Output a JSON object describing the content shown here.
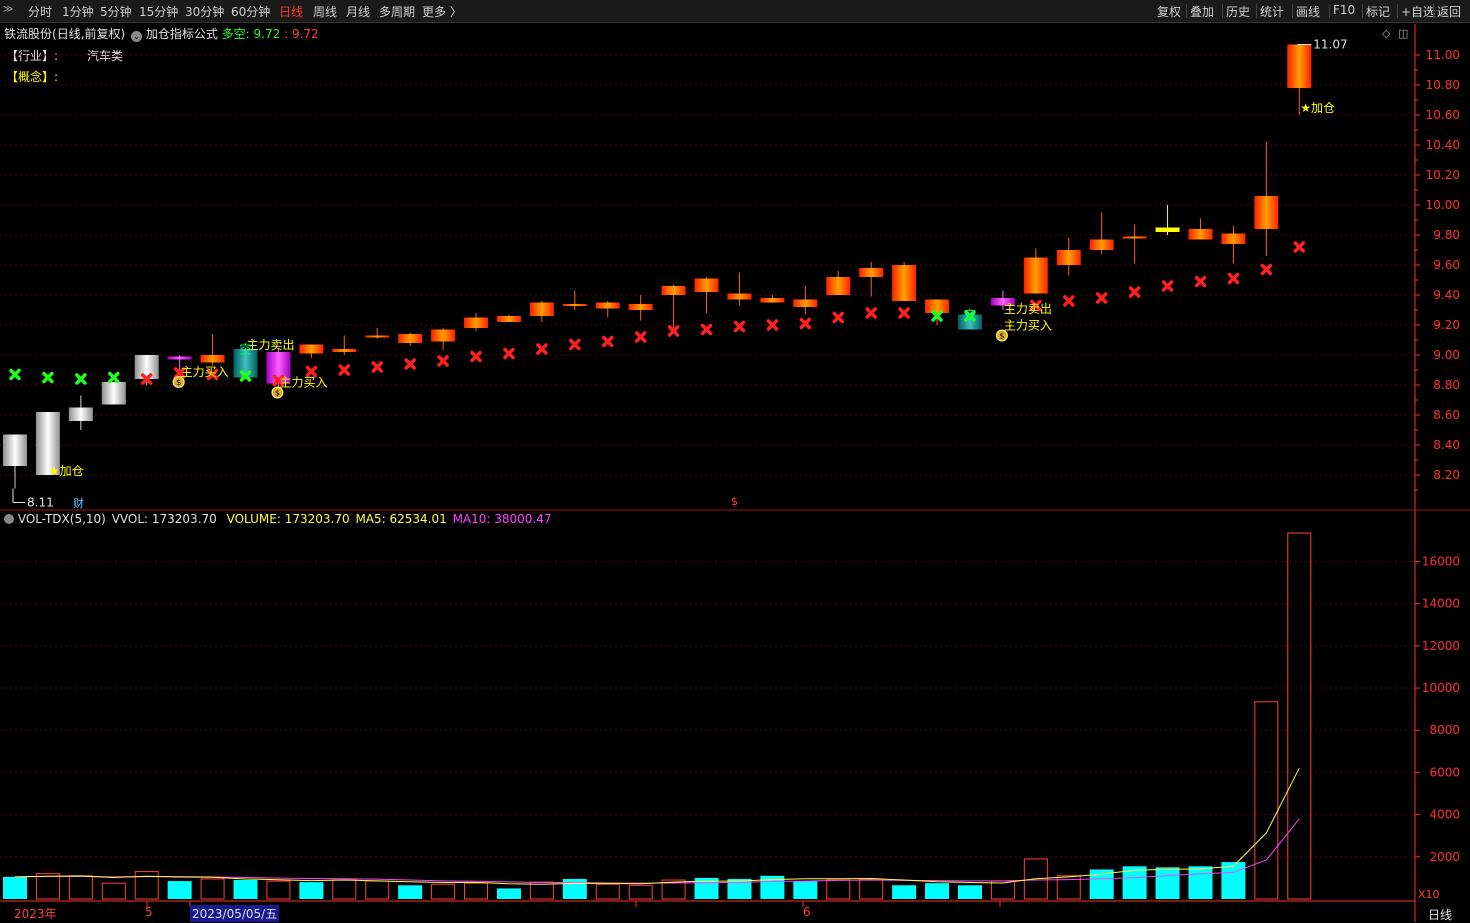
{
  "toolbar": {
    "left": [
      "分时",
      "1分钟",
      "5分钟",
      "15分钟",
      "30分钟",
      "60分钟",
      "日线",
      "周线",
      "月线",
      "多周期",
      "更多 〉"
    ],
    "active_index": 6,
    "right": [
      "复权",
      "叠加",
      "历史",
      "统计",
      "画线",
      "F10",
      "标记",
      "+自选",
      "返回"
    ]
  },
  "header": {
    "stock_name": "铁流股份",
    "mode": "(日线,前复权)",
    "formula": "加仓指标公式",
    "duokong_label": "多空:",
    "duokong_val1": "9.72",
    "duokong_val2": "9.72",
    "industry_label": "【行业】:",
    "industry_value": "汽车类",
    "concept_label": "【概念】:"
  },
  "volume_header": {
    "indicator": "VOL-TDX(5,10)",
    "vvol_label": "VVOL: 173203.70",
    "volume_label": "VOLUME: 173203.70",
    "ma5_label": "MA5: 62534.01",
    "ma10_label": "MA10: 38000.47"
  },
  "bottom": {
    "year_label": "2023年",
    "date_label": "2023/05/05/五",
    "month5": "5",
    "month6": "6",
    "period_label": "日线",
    "x10_label": "X10",
    "cai_label": "财",
    "dollar_label": "$"
  },
  "colors": {
    "up": "#ff4020",
    "down_white": "#e8e8e8",
    "vol_down": "#00ffff",
    "vol_up": "#ff4040",
    "ma5": "#ffff40",
    "ma10": "#ff40ff",
    "grid": "#4a0c0c",
    "axis": "#ff3030",
    "signal_red": "#ff2020",
    "signal_green": "#20ff20"
  },
  "chart_data": {
    "type": "candlestick",
    "y_axis": {
      "ticks": [
        "8.20",
        "8.40",
        "8.60",
        "8.80",
        "9.00",
        "9.20",
        "9.40",
        "9.60",
        "9.80",
        "10.00",
        "10.20",
        "10.40",
        "10.60",
        "10.80",
        "11.00"
      ],
      "range": [
        8.04,
        11.07
      ]
    },
    "candles": [
      {
        "o": 8.47,
        "c": 8.26,
        "h": 8.47,
        "l": 8.11,
        "style": "white"
      },
      {
        "o": 8.62,
        "c": 8.2,
        "h": 8.62,
        "l": 8.2,
        "style": "white"
      },
      {
        "o": 8.65,
        "c": 8.56,
        "h": 8.73,
        "l": 8.5,
        "style": "white"
      },
      {
        "o": 8.82,
        "c": 8.67,
        "h": 8.82,
        "l": 8.67,
        "style": "white"
      },
      {
        "o": 9.0,
        "c": 8.84,
        "h": 9.0,
        "l": 8.8,
        "style": "white"
      },
      {
        "o": 8.99,
        "c": 8.97,
        "h": 9.0,
        "l": 8.89,
        "style": "magenta"
      },
      {
        "o": 8.95,
        "c": 9.0,
        "h": 9.14,
        "l": 8.93,
        "style": "up"
      },
      {
        "o": 9.04,
        "c": 8.85,
        "h": 9.05,
        "l": 8.84,
        "style": "teal"
      },
      {
        "o": 8.81,
        "c": 9.02,
        "h": 9.04,
        "l": 8.78,
        "style": "magenta"
      },
      {
        "o": 9.01,
        "c": 9.07,
        "h": 9.07,
        "l": 8.98,
        "style": "up"
      },
      {
        "o": 9.02,
        "c": 9.04,
        "h": 9.13,
        "l": 9.0,
        "style": "up"
      },
      {
        "o": 9.12,
        "c": 9.13,
        "h": 9.18,
        "l": 9.11,
        "style": "up"
      },
      {
        "o": 9.08,
        "c": 9.14,
        "h": 9.15,
        "l": 9.06,
        "style": "up"
      },
      {
        "o": 9.09,
        "c": 9.17,
        "h": 9.18,
        "l": 9.03,
        "style": "up"
      },
      {
        "o": 9.18,
        "c": 9.25,
        "h": 9.28,
        "l": 9.16,
        "style": "up"
      },
      {
        "o": 9.22,
        "c": 9.26,
        "h": 9.27,
        "l": 9.22,
        "style": "up"
      },
      {
        "o": 9.26,
        "c": 9.35,
        "h": 9.36,
        "l": 9.22,
        "style": "up"
      },
      {
        "o": 9.33,
        "c": 9.34,
        "h": 9.43,
        "l": 9.3,
        "style": "up"
      },
      {
        "o": 9.31,
        "c": 9.35,
        "h": 9.36,
        "l": 9.25,
        "style": "up"
      },
      {
        "o": 9.3,
        "c": 9.34,
        "h": 9.4,
        "l": 9.23,
        "style": "up"
      },
      {
        "o": 9.4,
        "c": 9.46,
        "h": 9.47,
        "l": 9.18,
        "style": "up"
      },
      {
        "o": 9.42,
        "c": 9.51,
        "h": 9.52,
        "l": 9.28,
        "style": "up"
      },
      {
        "o": 9.37,
        "c": 9.41,
        "h": 9.55,
        "l": 9.33,
        "style": "up"
      },
      {
        "o": 9.35,
        "c": 9.38,
        "h": 9.4,
        "l": 9.35,
        "style": "up"
      },
      {
        "o": 9.32,
        "c": 9.37,
        "h": 9.46,
        "l": 9.27,
        "style": "up"
      },
      {
        "o": 9.4,
        "c": 9.52,
        "h": 9.56,
        "l": 9.4,
        "style": "up"
      },
      {
        "o": 9.52,
        "c": 9.58,
        "h": 9.62,
        "l": 9.39,
        "style": "up"
      },
      {
        "o": 9.36,
        "c": 9.6,
        "h": 9.62,
        "l": 9.36,
        "style": "up"
      },
      {
        "o": 9.28,
        "c": 9.37,
        "h": 9.37,
        "l": 9.2,
        "style": "up"
      },
      {
        "o": 9.27,
        "c": 9.17,
        "h": 9.28,
        "l": 9.17,
        "style": "teal"
      },
      {
        "o": 9.33,
        "c": 9.38,
        "h": 9.43,
        "l": 9.3,
        "style": "magenta"
      },
      {
        "o": 9.41,
        "c": 9.65,
        "h": 9.71,
        "l": 9.41,
        "style": "up"
      },
      {
        "o": 9.6,
        "c": 9.7,
        "h": 9.78,
        "l": 9.53,
        "style": "up"
      },
      {
        "o": 9.7,
        "c": 9.77,
        "h": 9.95,
        "l": 9.67,
        "style": "up"
      },
      {
        "o": 9.79,
        "c": 9.79,
        "h": 9.87,
        "l": 9.61,
        "style": "up"
      },
      {
        "o": 9.82,
        "c": 9.85,
        "h": 10.0,
        "l": 9.8,
        "style": "yellow"
      },
      {
        "o": 9.77,
        "c": 9.84,
        "h": 9.91,
        "l": 9.77,
        "style": "up"
      },
      {
        "o": 9.74,
        "c": 9.81,
        "h": 9.86,
        "l": 9.61,
        "style": "up"
      },
      {
        "o": 9.84,
        "c": 10.06,
        "h": 10.42,
        "l": 9.66,
        "style": "up"
      },
      {
        "o": 10.78,
        "c": 11.07,
        "h": 11.07,
        "l": 10.6,
        "style": "up"
      }
    ],
    "signal_marks": [
      {
        "i": 0,
        "price": 8.87,
        "type": "green"
      },
      {
        "i": 1,
        "price": 8.85,
        "type": "green"
      },
      {
        "i": 2,
        "price": 8.84,
        "type": "green"
      },
      {
        "i": 3,
        "price": 8.85,
        "type": "green"
      },
      {
        "i": 4,
        "price": 8.84,
        "type": "red"
      },
      {
        "i": 5,
        "price": 8.88,
        "type": "red"
      },
      {
        "i": 6,
        "price": 8.87,
        "type": "red"
      },
      {
        "i": 7,
        "price": 8.86,
        "type": "green"
      },
      {
        "i": 8,
        "price": 8.83,
        "type": "red"
      },
      {
        "i": 9,
        "price": 8.89,
        "type": "red"
      },
      {
        "i": 10,
        "price": 8.9,
        "type": "red"
      },
      {
        "i": 11,
        "price": 8.92,
        "type": "red"
      },
      {
        "i": 12,
        "price": 8.94,
        "type": "red"
      },
      {
        "i": 13,
        "price": 8.96,
        "type": "red"
      },
      {
        "i": 14,
        "price": 8.99,
        "type": "red"
      },
      {
        "i": 15,
        "price": 9.01,
        "type": "red"
      },
      {
        "i": 16,
        "price": 9.04,
        "type": "red"
      },
      {
        "i": 17,
        "price": 9.07,
        "type": "red"
      },
      {
        "i": 18,
        "price": 9.09,
        "type": "red"
      },
      {
        "i": 19,
        "price": 9.12,
        "type": "red"
      },
      {
        "i": 20,
        "price": 9.16,
        "type": "red"
      },
      {
        "i": 21,
        "price": 9.17,
        "type": "red"
      },
      {
        "i": 22,
        "price": 9.19,
        "type": "red"
      },
      {
        "i": 23,
        "price": 9.2,
        "type": "red"
      },
      {
        "i": 24,
        "price": 9.21,
        "type": "red"
      },
      {
        "i": 25,
        "price": 9.25,
        "type": "red"
      },
      {
        "i": 26,
        "price": 9.28,
        "type": "red"
      },
      {
        "i": 27,
        "price": 9.28,
        "type": "red"
      },
      {
        "i": 28,
        "price": 9.26,
        "type": "green"
      },
      {
        "i": 29,
        "price": 9.26,
        "type": "green"
      },
      {
        "i": 31,
        "price": 9.33,
        "type": "red"
      },
      {
        "i": 32,
        "price": 9.36,
        "type": "red"
      },
      {
        "i": 33,
        "price": 9.38,
        "type": "red"
      },
      {
        "i": 34,
        "price": 9.42,
        "type": "red"
      },
      {
        "i": 35,
        "price": 9.46,
        "type": "red"
      },
      {
        "i": 36,
        "price": 9.49,
        "type": "red"
      },
      {
        "i": 37,
        "price": 9.51,
        "type": "red"
      },
      {
        "i": 38,
        "price": 9.57,
        "type": "red"
      },
      {
        "i": 39,
        "price": 9.72,
        "type": "red"
      }
    ],
    "annotations": [
      {
        "i": 1,
        "price": 8.2,
        "text": "★加仓",
        "color": "#ffff00"
      },
      {
        "i": 39,
        "price": 10.62,
        "text": "★加仓",
        "color": "#ffff00"
      },
      {
        "i": 5,
        "price": 8.86,
        "text": "主力买入",
        "color": "#ffff00",
        "coin": true
      },
      {
        "i": 8,
        "price": 8.79,
        "text": "主力买入",
        "color": "#ffff00",
        "coin": true
      },
      {
        "i": 7,
        "price": 9.04,
        "text": "主力卖出",
        "color": "#ffff00"
      },
      {
        "i": 30,
        "price": 9.28,
        "text": "主力卖出",
        "color": "#ffff00"
      },
      {
        "i": 30,
        "price": 9.17,
        "text": "主力买入",
        "color": "#ffff00",
        "coin": true
      },
      {
        "i": 7,
        "price": 9.01,
        "text": "空",
        "color": "#00ff80"
      },
      {
        "i": 29,
        "price": 9.24,
        "text": "空",
        "color": "#00ff80"
      }
    ],
    "price_labels": [
      {
        "i": 0,
        "price": 8.11,
        "text": "8.11"
      },
      {
        "i": 39,
        "price": 11.07,
        "text": "11.07"
      }
    ],
    "volume": {
      "y_ticks": [
        "2000",
        "4000",
        "6000",
        "8000",
        "10000",
        "12000",
        "14000",
        "16000"
      ],
      "range": [
        0,
        17600
      ],
      "bars": [
        {
          "v": 1050,
          "dir": "down"
        },
        {
          "v": 1200,
          "dir": "up"
        },
        {
          "v": 1100,
          "dir": "up"
        },
        {
          "v": 750,
          "dir": "up"
        },
        {
          "v": 1300,
          "dir": "up"
        },
        {
          "v": 850,
          "dir": "down"
        },
        {
          "v": 950,
          "dir": "up"
        },
        {
          "v": 900,
          "dir": "down"
        },
        {
          "v": 850,
          "dir": "up"
        },
        {
          "v": 800,
          "dir": "down"
        },
        {
          "v": 900,
          "dir": "up"
        },
        {
          "v": 850,
          "dir": "up"
        },
        {
          "v": 650,
          "dir": "down"
        },
        {
          "v": 700,
          "dir": "up"
        },
        {
          "v": 750,
          "dir": "up"
        },
        {
          "v": 500,
          "dir": "down"
        },
        {
          "v": 800,
          "dir": "up"
        },
        {
          "v": 950,
          "dir": "down"
        },
        {
          "v": 700,
          "dir": "up"
        },
        {
          "v": 650,
          "dir": "up"
        },
        {
          "v": 900,
          "dir": "up"
        },
        {
          "v": 1000,
          "dir": "down"
        },
        {
          "v": 950,
          "dir": "down"
        },
        {
          "v": 1100,
          "dir": "down"
        },
        {
          "v": 850,
          "dir": "down"
        },
        {
          "v": 900,
          "dir": "up"
        },
        {
          "v": 950,
          "dir": "up"
        },
        {
          "v": 650,
          "dir": "down"
        },
        {
          "v": 750,
          "dir": "down"
        },
        {
          "v": 650,
          "dir": "down"
        },
        {
          "v": 850,
          "dir": "up"
        },
        {
          "v": 1900,
          "dir": "up"
        },
        {
          "v": 1100,
          "dir": "up"
        },
        {
          "v": 1400,
          "dir": "down"
        },
        {
          "v": 1550,
          "dir": "down"
        },
        {
          "v": 1500,
          "dir": "down"
        },
        {
          "v": 1550,
          "dir": "down"
        },
        {
          "v": 1750,
          "dir": "down"
        },
        {
          "v": 9350,
          "dir": "up"
        },
        {
          "v": 17350,
          "dir": "up"
        }
      ],
      "ma5": [
        1050,
        1080,
        1090,
        1020,
        1080,
        1040,
        1030,
        950,
        910,
        870,
        900,
        860,
        820,
        780,
        790,
        720,
        700,
        740,
        740,
        720,
        800,
        850,
        850,
        920,
        960,
        960,
        970,
        900,
        820,
        780,
        760,
        960,
        1050,
        1180,
        1360,
        1410,
        1420,
        1560,
        3130,
        6200
      ],
      "ma10": [
        1050,
        1070,
        1070,
        1050,
        1060,
        1060,
        1050,
        1020,
        990,
        970,
        960,
        940,
        900,
        860,
        840,
        810,
        780,
        780,
        760,
        750,
        760,
        770,
        790,
        830,
        850,
        880,
        900,
        880,
        870,
        860,
        860,
        900,
        920,
        960,
        1010,
        1110,
        1190,
        1260,
        1850,
        3800
      ]
    }
  }
}
